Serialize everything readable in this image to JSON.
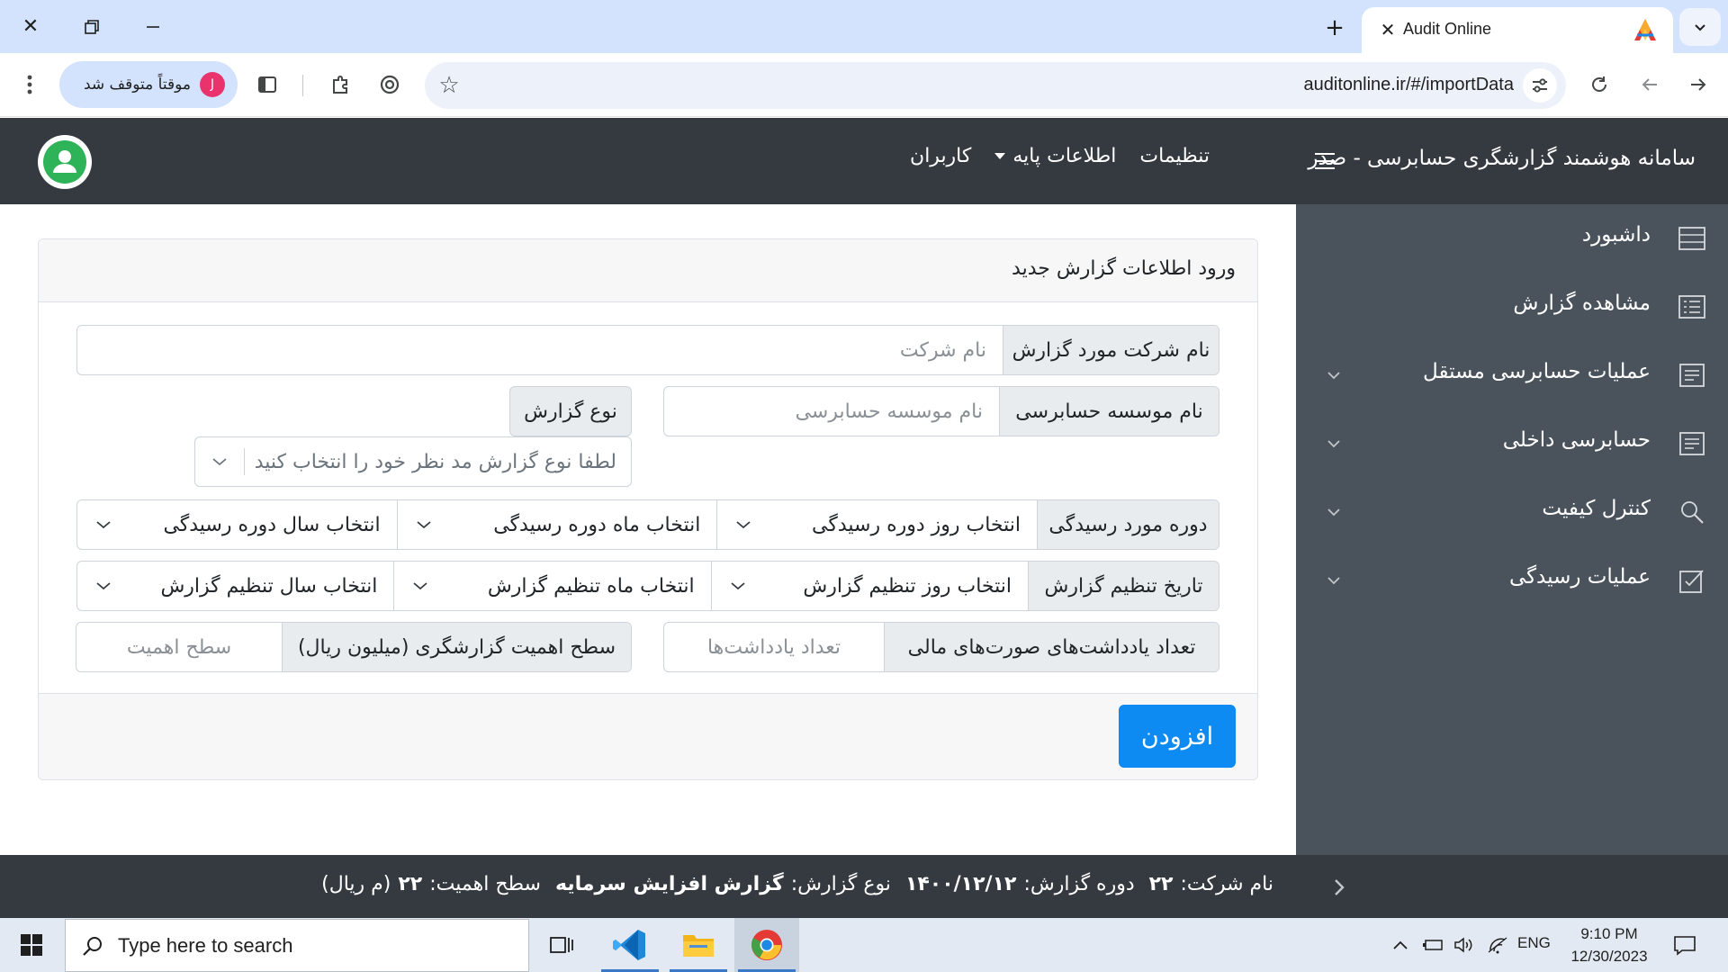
{
  "browser": {
    "tab_title": "Audit Online",
    "url": "auditonline.ir/#/importData",
    "profile_label": "موقتاً متوقف شد",
    "profile_initial": "J"
  },
  "navbar": {
    "brand": "سامانه هوشمند گزارشگری حسابرسی - صدر",
    "links": [
      "تنظیمات",
      "اطلاعات پایه",
      "کاربران"
    ]
  },
  "sidebar": {
    "items": [
      {
        "label": "داشبورد",
        "icon": "list-icon",
        "expandable": false
      },
      {
        "label": "مشاهده گزارش",
        "icon": "report-list-icon",
        "expandable": false
      },
      {
        "label": "عملیات حسابرسی مستقل",
        "icon": "document-icon",
        "expandable": true
      },
      {
        "label": "حسابرسی داخلی",
        "icon": "document-icon",
        "expandable": true
      },
      {
        "label": "کنترل کیفیت",
        "icon": "search-icon",
        "expandable": true
      },
      {
        "label": "عملیات رسیدگی",
        "icon": "checkbox-edit-icon",
        "expandable": true
      }
    ]
  },
  "form": {
    "title": "ورود اطلاعات گزارش جدید",
    "company": {
      "label": "نام شرکت مورد گزارش",
      "placeholder": "نام شرکت"
    },
    "audit_firm": {
      "label": "نام موسسه حسابرسی",
      "placeholder": "نام موسسه حسابرسی"
    },
    "report_type": {
      "label": "نوع گزارش",
      "placeholder": "لطفا نوع گزارش مد نظر خود را انتخاب کنید"
    },
    "review_period": {
      "label": "دوره مورد رسیدگی",
      "day": "انتخاب روز دوره رسیدگی",
      "month": "انتخاب ماه دوره رسیدگی",
      "year": "انتخاب سال دوره رسیدگی"
    },
    "report_date": {
      "label": "تاریخ تنظیم گزارش",
      "day": "انتخاب روز تنظیم گزارش",
      "month": "انتخاب ماه تنظیم گزارش",
      "year": "انتخاب سال تنظیم گزارش"
    },
    "notes_count": {
      "label": "تعداد یادداشت‌های صورت‌های مالی",
      "placeholder": "تعداد یادداشت‌ها"
    },
    "materiality": {
      "label": "سطح اهمیت گزارشگری (میلیون ریال)",
      "placeholder": "سطح اهمیت"
    },
    "submit_label": "افزودن"
  },
  "status": {
    "company_label": "نام شرکت:",
    "company_value": "۲۲",
    "period_label": "دوره گزارش:",
    "period_value": "۱۴۰۰/۱۲/۱۲",
    "type_label": "نوع گزارش:",
    "type_value": "گزارش افزایش سرمایه",
    "materiality_label": "سطح اهمیت:",
    "materiality_value": "۲۲",
    "materiality_unit": "(م ریال)"
  },
  "taskbar": {
    "search_placeholder": "Type here to search",
    "language": "ENG",
    "time": "9:10 PM",
    "date": "12/30/2023"
  }
}
